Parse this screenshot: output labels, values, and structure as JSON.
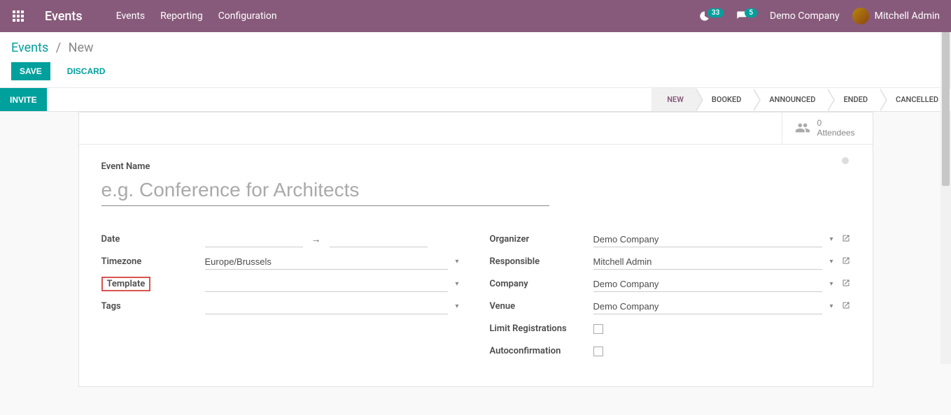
{
  "topnav": {
    "brand": "Events",
    "menu": [
      "Events",
      "Reporting",
      "Configuration"
    ],
    "activity_count": "33",
    "message_count": "5",
    "company": "Demo Company",
    "user": "Mitchell Admin"
  },
  "breadcrumb": {
    "root": "Events",
    "current": "New"
  },
  "buttons": {
    "save": "SAVE",
    "discard": "DISCARD",
    "invite": "INVITE"
  },
  "status_steps": [
    "NEW",
    "BOOKED",
    "ANNOUNCED",
    "ENDED",
    "CANCELLED"
  ],
  "status_active_index": 0,
  "attendees": {
    "count": "0",
    "label": "Attendees"
  },
  "form": {
    "title_label": "Event Name",
    "title_placeholder": "e.g. Conference for Architects",
    "title_value": "",
    "left": {
      "date_label": "Date",
      "date_start": "",
      "date_end": "",
      "timezone_label": "Timezone",
      "timezone_value": "Europe/Brussels",
      "template_label": "Template",
      "template_value": "",
      "tags_label": "Tags",
      "tags_value": ""
    },
    "right": {
      "organizer_label": "Organizer",
      "organizer_value": "Demo Company",
      "responsible_label": "Responsible",
      "responsible_value": "Mitchell Admin",
      "company_label": "Company",
      "company_value": "Demo Company",
      "venue_label": "Venue",
      "venue_value": "Demo Company",
      "limit_label": "Limit Registrations",
      "limit_checked": false,
      "autoconfirm_label": "Autoconfirmation",
      "autoconfirm_checked": false
    }
  }
}
